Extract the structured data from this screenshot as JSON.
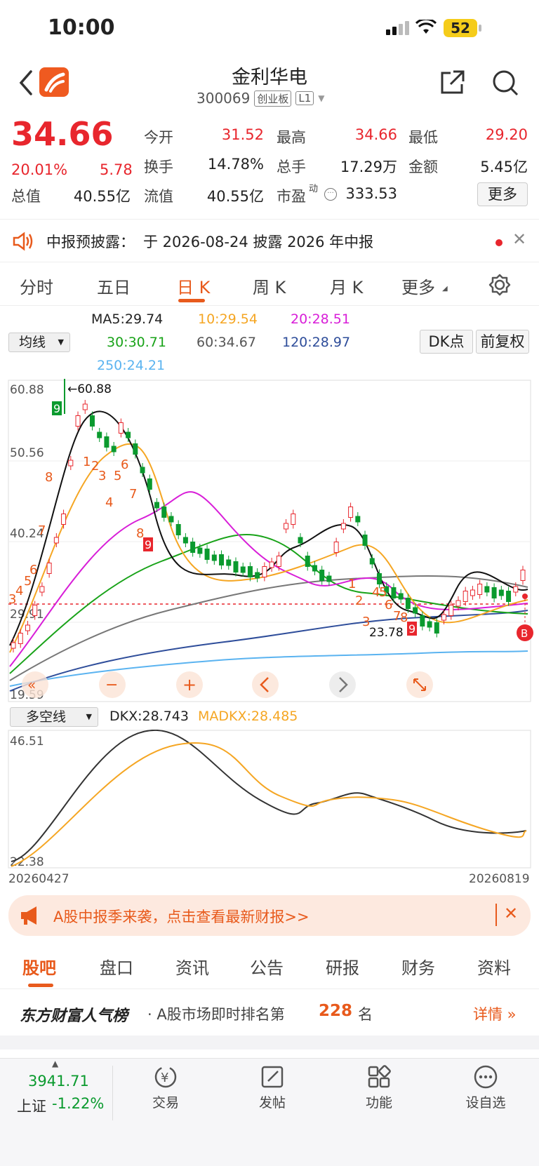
{
  "status": {
    "time": "10:00",
    "battery": "52"
  },
  "header": {
    "title": "金利华电",
    "code": "300069",
    "board": "创业板",
    "level": "L1"
  },
  "quote": {
    "price": "34.66",
    "pct": "20.01%",
    "change": "5.78",
    "row1": [
      {
        "label": "今开",
        "value": "31.52",
        "color": "red"
      },
      {
        "label": "最高",
        "value": "34.66",
        "color": "red"
      },
      {
        "label": "最低",
        "value": "29.20",
        "color": "red"
      }
    ],
    "row2": [
      {
        "label": "换手",
        "value": "14.78%"
      },
      {
        "label": "总手",
        "value": "17.29万"
      },
      {
        "label": "金额",
        "value": "5.45亿"
      }
    ],
    "row3": [
      {
        "label": "总值",
        "value": "40.55亿"
      },
      {
        "label": "流值",
        "value": "40.55亿"
      },
      {
        "label": "市盈",
        "sup": "动",
        "value": "333.53"
      }
    ],
    "more": "更多"
  },
  "notice": {
    "label": "中报预披露：",
    "text": "于 2026-08-24 披露 2026 年中报"
  },
  "tabs": [
    "分时",
    "五日",
    "日 K",
    "周 K",
    "月 K",
    "更多"
  ],
  "ma": {
    "selector": "均线",
    "items": [
      {
        "text": "MA5:29.74",
        "color": "#222"
      },
      {
        "text": "10:29.54",
        "color": "#f5a623"
      },
      {
        "text": "20:28.51",
        "color": "#d81ed8"
      },
      {
        "text": "30:30.71",
        "color": "#19a319"
      },
      {
        "text": "60:34.67",
        "color": "#555"
      },
      {
        "text": "120:28.97",
        "color": "#2e4d9a"
      },
      {
        "text": "250:24.21",
        "color": "#5ab3f0"
      }
    ],
    "dk_button": "DK点",
    "adjust_button": "前复权"
  },
  "kline": {
    "y_labels": [
      "60.88",
      "50.56",
      "40.24",
      "29.91",
      "19.59"
    ],
    "high_label": "←60.88",
    "low_label": "23.78",
    "b_marker": "B"
  },
  "indicator": {
    "selector": "多空线",
    "dkx": "DKX:28.743",
    "madkx": "MADKX:28.485",
    "y_top": "46.51",
    "y_bottom": "22.38",
    "date_start": "20260427",
    "date_end": "20260819"
  },
  "colors": {
    "up": "#e8262d",
    "down": "#0a9a2e",
    "accent": "#e85a1c"
  },
  "ad": {
    "text": "A股中报季来袭，点击查看最新财报>>"
  },
  "subtabs": [
    "股吧",
    "盘口",
    "资讯",
    "公告",
    "研报",
    "财务",
    "资料"
  ],
  "rank": {
    "brand": "东方财富人气榜",
    "prefix": "· A股市场即时排名第",
    "rank": "228",
    "suffix": "名",
    "detail": "详情"
  },
  "bottomnav": {
    "index_value": "3941.71",
    "index_name": "上证",
    "index_pct": "-1.22%",
    "items": [
      "交易",
      "发帖",
      "功能",
      "设自选"
    ]
  }
}
